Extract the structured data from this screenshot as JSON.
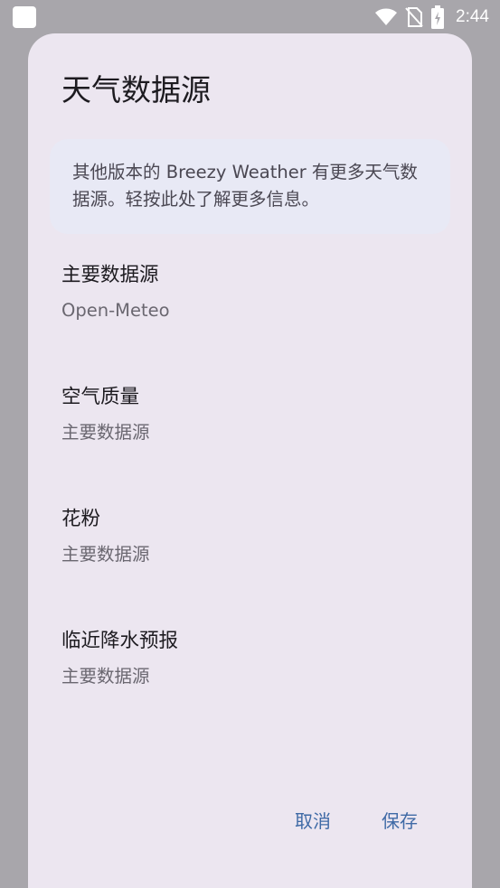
{
  "status_bar": {
    "time": "2:44",
    "icons": [
      "notification-icon",
      "wifi-icon",
      "no-sim-icon",
      "battery-charging-icon"
    ]
  },
  "dialog": {
    "title": "天气数据源",
    "info_card": "其他版本的 Breezy Weather 有更多天气数据源。轻按此处了解更多信息。",
    "items": [
      {
        "title": "主要数据源",
        "summary": "Open-Meteo"
      },
      {
        "title": "空气质量",
        "summary": "主要数据源"
      },
      {
        "title": "花粉",
        "summary": "主要数据源"
      },
      {
        "title": "临近降水预报",
        "summary": "主要数据源"
      }
    ],
    "buttons": {
      "cancel": "取消",
      "save": "保存"
    }
  },
  "colors": {
    "scrim": "#a8a6ab",
    "dialog_bg": "#ece6f0",
    "card_bg": "#e8e9f5",
    "accent": "#3f6aa6"
  }
}
